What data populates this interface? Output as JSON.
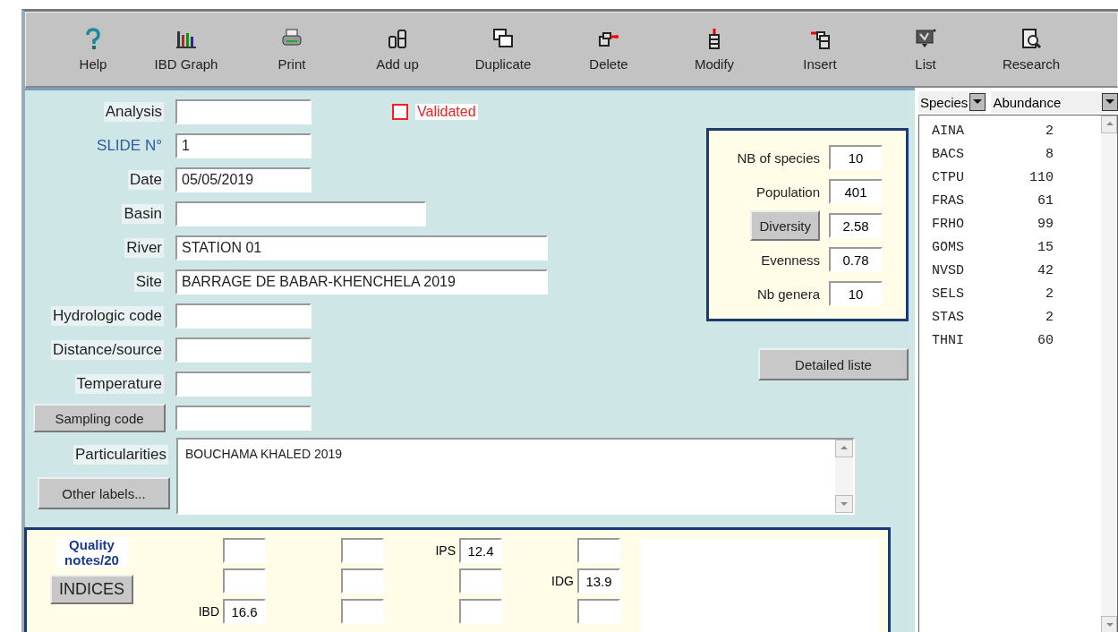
{
  "toolbar": [
    {
      "label": "Help"
    },
    {
      "label": "IBD Graph"
    },
    {
      "label": "Print"
    },
    {
      "label": "Add up"
    },
    {
      "label": "Duplicate"
    },
    {
      "label": "Delete"
    },
    {
      "label": "Modify"
    },
    {
      "label": "Insert"
    },
    {
      "label": "List"
    },
    {
      "label": "Research"
    }
  ],
  "form": {
    "validated": {
      "label": "Validated",
      "checked": false
    },
    "fields": [
      {
        "kind": "text",
        "label": "Analysis"
      },
      {
        "kind": "link",
        "label": "SLIDE N°",
        "value": "1"
      },
      {
        "kind": "text",
        "label": "Date",
        "value": "05/05/2019"
      },
      {
        "kind": "text",
        "label": "Basin"
      },
      {
        "kind": "text",
        "label": "River",
        "value": "STATION 01"
      },
      {
        "kind": "text",
        "label": "Site",
        "value": "BARRAGE DE BABAR-KHENCHELA 2019"
      },
      {
        "kind": "text",
        "label": "Hydrologic code"
      },
      {
        "kind": "text",
        "label": "Distance/source"
      },
      {
        "kind": "text",
        "label": "Temperature"
      },
      {
        "kind": "button",
        "label": "Sampling code"
      }
    ],
    "particularities": {
      "label": "Particularities",
      "value": "BOUCHAMA KHALED 2019",
      "button": "Other labels..."
    }
  },
  "stats": {
    "rows": [
      {
        "kind": "text",
        "label": "NB of species",
        "value": "10"
      },
      {
        "kind": "text",
        "label": "Population",
        "value": "401"
      },
      {
        "kind": "button",
        "label": "Diversity",
        "value": "2.58"
      },
      {
        "kind": "text",
        "label": "Evenness",
        "value": "0.78"
      },
      {
        "kind": "text",
        "label": "Nb genera",
        "value": "10"
      }
    ],
    "button": "Detailed liste"
  },
  "quality": {
    "title": "Quality notes/20",
    "button": "INDICES",
    "columns": [
      [
        {},
        {},
        {
          "label": "IBD",
          "value": "16.6"
        }
      ],
      [
        {},
        {},
        {}
      ],
      [
        {
          "label": "IPS",
          "value": "12.4"
        },
        {},
        {}
      ],
      [
        {},
        {
          "label": "IDG",
          "value": "13.9"
        },
        {}
      ]
    ]
  },
  "species_list": {
    "columns": [
      "Species",
      "Abundance"
    ],
    "rows": [
      {
        "code": "AINA",
        "count": "2"
      },
      {
        "code": "BACS",
        "count": "8"
      },
      {
        "code": "CTPU",
        "count": "110"
      },
      {
        "code": "FRAS",
        "count": "61"
      },
      {
        "code": "FRHO",
        "count": "99"
      },
      {
        "code": "GOMS",
        "count": "15"
      },
      {
        "code": "NVSD",
        "count": "42"
      },
      {
        "code": "SELS",
        "count": "2"
      },
      {
        "code": "STAS",
        "count": "2"
      },
      {
        "code": "THNI",
        "count": "60"
      }
    ]
  }
}
